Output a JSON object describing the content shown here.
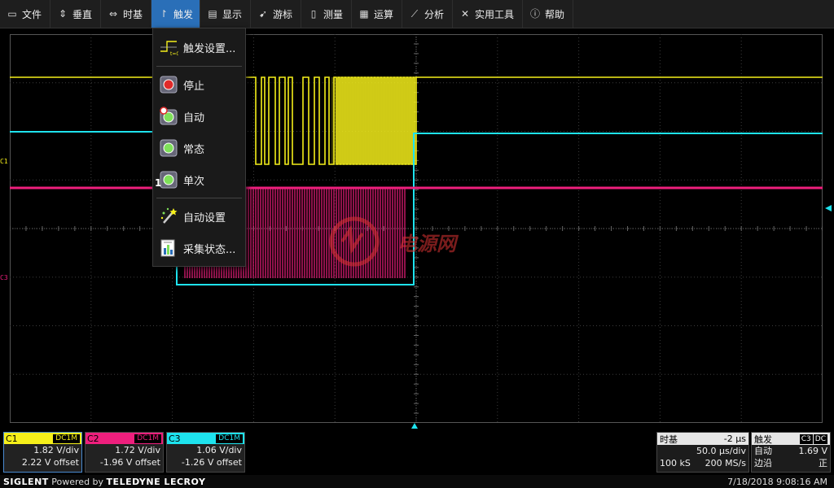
{
  "menubar": {
    "items": [
      {
        "label": "文件",
        "icon": "folder-icon",
        "glyph": "▭"
      },
      {
        "label": "垂直",
        "icon": "vertical-arrows-icon",
        "glyph": "⇕"
      },
      {
        "label": "时基",
        "icon": "horizontal-arrows-icon",
        "glyph": "⇔"
      },
      {
        "label": "触发",
        "icon": "trigger-edge-icon",
        "glyph": "↾"
      },
      {
        "label": "显示",
        "icon": "display-icon",
        "glyph": "▤"
      },
      {
        "label": "游标",
        "icon": "cursor-icon",
        "glyph": "➹"
      },
      {
        "label": "测量",
        "icon": "measure-icon",
        "glyph": "▯"
      },
      {
        "label": "运算",
        "icon": "math-icon",
        "glyph": "▦"
      },
      {
        "label": "分析",
        "icon": "analysis-icon",
        "glyph": "⟋"
      },
      {
        "label": "实用工具",
        "icon": "tools-icon",
        "glyph": "✕"
      },
      {
        "label": "帮助",
        "icon": "help-icon",
        "glyph": "ⓘ"
      }
    ],
    "active_index": 3
  },
  "trigger_menu": {
    "items": [
      {
        "label": "触发设置...",
        "icon": "trigger-setup-icon"
      },
      {
        "label": "停止",
        "icon": "stop-icon"
      },
      {
        "label": "自动",
        "icon": "auto-icon"
      },
      {
        "label": "常态",
        "icon": "normal-icon"
      },
      {
        "label": "单次",
        "icon": "single-icon"
      },
      {
        "label": "自动设置",
        "icon": "auto-setup-icon"
      },
      {
        "label": "采集状态...",
        "icon": "acquisition-status-icon"
      }
    ]
  },
  "channel_markers": {
    "c1": "C1",
    "c3": "C3",
    "one": "1"
  },
  "channels": [
    {
      "name": "C1",
      "coupling": "DC1M",
      "vdiv": "1.82 V/div",
      "offset": "2.22 V offset",
      "color": "#f5ef1a"
    },
    {
      "name": "C2",
      "coupling": "DC1M",
      "vdiv": "1.72 V/div",
      "offset": "-1.96 V offset",
      "color": "#ee1f7d"
    },
    {
      "name": "C3",
      "coupling": "DC1M",
      "vdiv": "1.06 V/div",
      "offset": "-1.26 V offset",
      "color": "#1ee3ee"
    }
  ],
  "timebase": {
    "label": "时基",
    "delay": "-2 µs",
    "tdiv": "50.0 µs/div",
    "points": "100 kS",
    "rate": "200 MS/s"
  },
  "trigger": {
    "label": "触发",
    "source": "C3",
    "coupling": "DC",
    "mode": "自动",
    "level": "1.69 V",
    "type": "边沿",
    "slope": "正"
  },
  "footer": {
    "brand": "SIGLENT",
    "powered": "Powered by",
    "partner": "TELEDYNE LECROY",
    "datetime": "7/18/2018 9:08:16 AM"
  },
  "watermark": {
    "text": "电源网"
  },
  "colors": {
    "c1": "#f5ef1a",
    "c2": "#ee1f7d",
    "c3": "#1ee3ee",
    "grid": "#3c3c3c",
    "menu_active": "#2a6fb8"
  }
}
